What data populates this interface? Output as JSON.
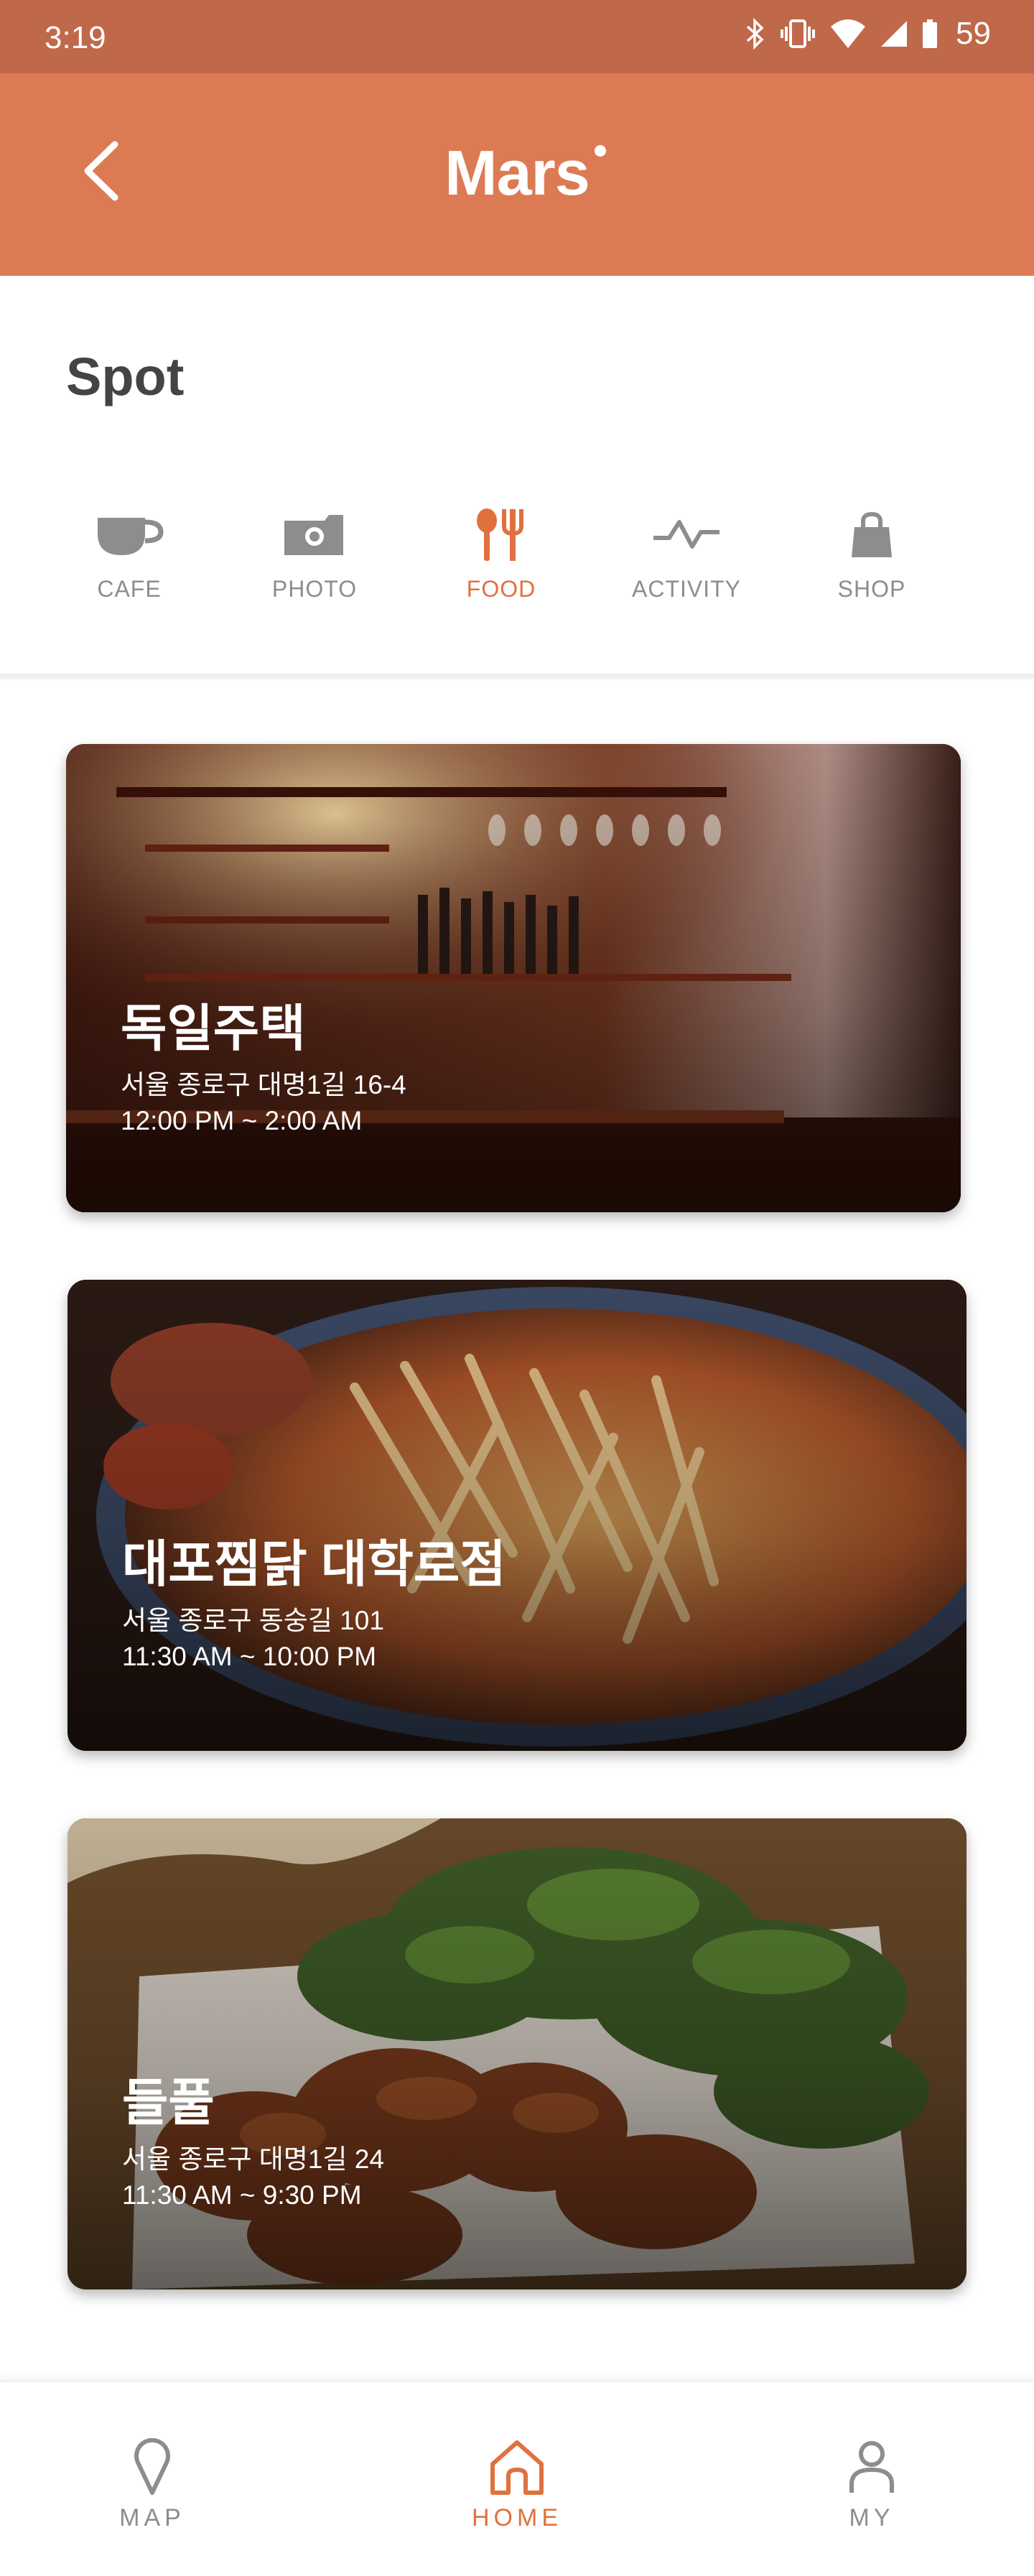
{
  "status_bar": {
    "time": "3:19",
    "battery": "59"
  },
  "app_bar": {
    "title": "Mars"
  },
  "section": {
    "title": "Spot"
  },
  "categories": [
    {
      "label": "CAFE",
      "icon": "cup-icon",
      "active": false
    },
    {
      "label": "PHOTO",
      "icon": "camera-icon",
      "active": false
    },
    {
      "label": "FOOD",
      "icon": "fork-knife-icon",
      "active": true
    },
    {
      "label": "ACTIVITY",
      "icon": "pulse-icon",
      "active": false
    },
    {
      "label": "SHOP",
      "icon": "shopping-bag-icon",
      "active": false
    }
  ],
  "spots": [
    {
      "name": "독일주택",
      "address": "서울 종로구 대명1길 16-4",
      "hours": "12:00 PM ~ 2:00 AM"
    },
    {
      "name": "대포찜닭 대학로점",
      "address": "서울 종로구 동숭길 101",
      "hours": "11:30 AM ~ 10:00 PM"
    },
    {
      "name": "들풀",
      "address": "서울 종로구 대명1길 24",
      "hours": "11:30 AM ~ 9:30 PM"
    }
  ],
  "bottom_nav": [
    {
      "label": "MAP",
      "icon": "map-pin-icon",
      "active": false
    },
    {
      "label": "HOME",
      "icon": "home-icon",
      "active": true
    },
    {
      "label": "MY",
      "icon": "user-icon",
      "active": false
    }
  ],
  "colors": {
    "accent": "#dc7b53",
    "status_bar": "#c0684a",
    "active": "#e0713f",
    "inactive": "#8d8d8d"
  }
}
